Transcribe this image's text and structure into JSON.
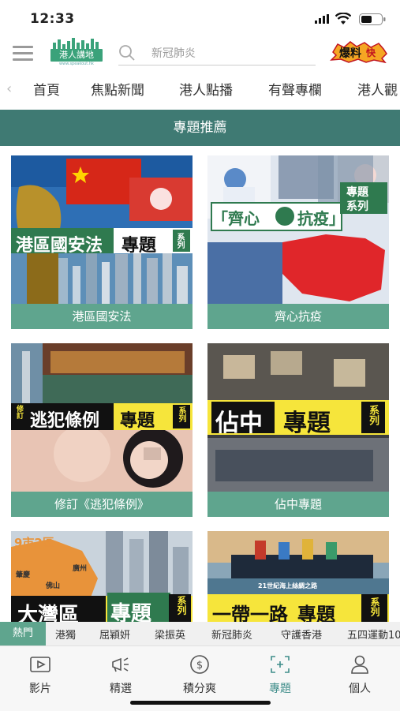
{
  "status": {
    "time": "12:33"
  },
  "header": {
    "logo_text": "港人講地",
    "logo_url": "www.speakout.hk",
    "search_placeholder": "新冠肺炎",
    "brand_logo_text": "爆料",
    "brand_logo_sub": "快"
  },
  "nav": {
    "tabs": [
      "首頁",
      "焦點新聞",
      "港人點播",
      "有聲專欄",
      "港人觀"
    ]
  },
  "section": {
    "title": "專題推薦"
  },
  "cards": [
    {
      "label": "港區國安法",
      "banner": "港區國安法",
      "banner_tag": "專題",
      "series": "系列"
    },
    {
      "label": "齊心抗疫",
      "banner": "「齊心",
      "banner2": "抗疫」",
      "banner_tag": "專題",
      "series": "系列"
    },
    {
      "label": "修訂《逃犯條例》",
      "banner": "逃犯條例",
      "banner_prefix": "修訂",
      "banner_tag": "專題",
      "series": "系列"
    },
    {
      "label": "佔中專題",
      "banner": "佔中",
      "banner_tag": "專題",
      "series": "系列"
    },
    {
      "label": "",
      "banner": "大灣區",
      "banner_tag": "專題",
      "series": "系列",
      "corner": "9市2區",
      "places": [
        "肇慶",
        "廣州",
        "佛山"
      ]
    },
    {
      "label": "",
      "banner": "一帶一路",
      "banner_tag": "專題",
      "series": "系列",
      "caption": "21世紀海上絲綢之路"
    }
  ],
  "hotbar": {
    "label": "熱門",
    "items": [
      "港獨",
      "屈穎妍",
      "梁振英",
      "新冠肺炎",
      "守護香港",
      "五四運動10"
    ]
  },
  "bottom_tabs": [
    {
      "label": "影片",
      "icon": "video-icon"
    },
    {
      "label": "精選",
      "icon": "megaphone-icon"
    },
    {
      "label": "積分爽",
      "icon": "dollar-coin-icon"
    },
    {
      "label": "專題",
      "icon": "topic-frame-icon",
      "active": true
    },
    {
      "label": "個人",
      "icon": "person-icon"
    }
  ],
  "colors": {
    "teal_header": "#3f7a73",
    "teal_label": "#5fa58e",
    "active_tab": "#3f8d8a"
  }
}
